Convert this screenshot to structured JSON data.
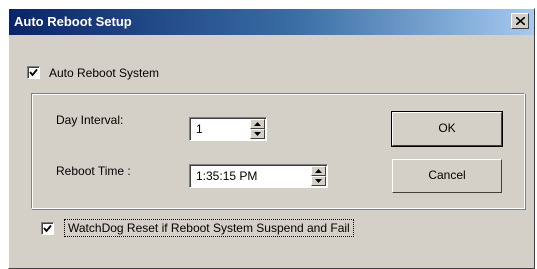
{
  "window": {
    "title": "Auto Reboot Setup"
  },
  "auto_reboot": {
    "label": "Auto Reboot System",
    "checked": true
  },
  "day_interval": {
    "label": "Day Interval:",
    "value": "1"
  },
  "reboot_time": {
    "label": "Reboot Time :",
    "value": "1:35:15 PM"
  },
  "buttons": {
    "ok": "OK",
    "cancel": "Cancel"
  },
  "watchdog": {
    "label": "WatchDog Reset if Reboot System Suspend and Fail",
    "checked": true
  },
  "icons": {
    "close": "close-icon",
    "check": "check-icon",
    "spin_up": "spin-up-icon",
    "spin_down": "spin-down-icon"
  }
}
